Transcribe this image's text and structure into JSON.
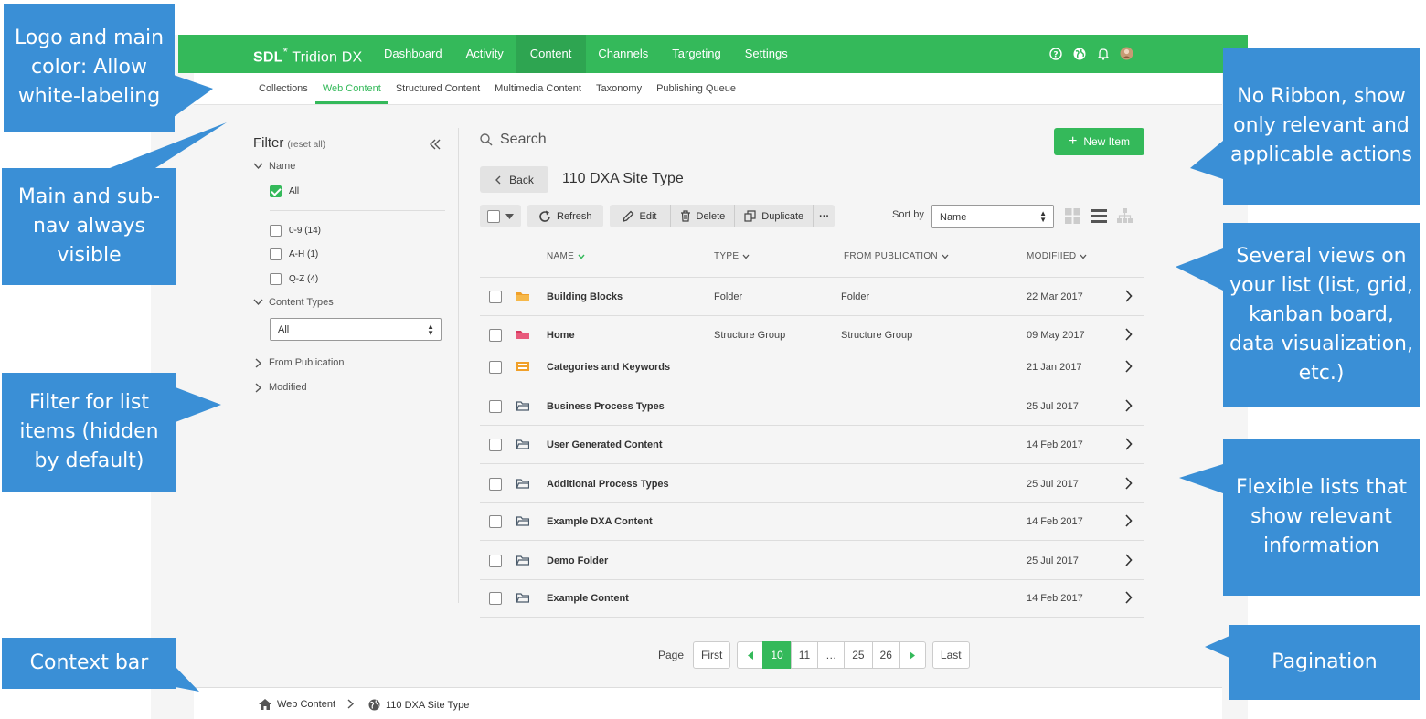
{
  "brand": {
    "logo_bold": "SDL",
    "logo_star": "*",
    "logo_rest": " Tridion DX",
    "color": "#34b95a"
  },
  "nav": {
    "items": [
      "Dashboard",
      "Activity",
      "Content",
      "Channels",
      "Targeting",
      "Settings"
    ],
    "active": "Content"
  },
  "top_icons": [
    "help-icon",
    "globe-icon",
    "bell-icon",
    "avatar"
  ],
  "subnav": {
    "items": [
      "Collections",
      "Web Content",
      "Structured Content",
      "Multimedia Content",
      "Taxonomy",
      "Publishing Queue"
    ],
    "active": "Web Content"
  },
  "filter": {
    "title": "Filter",
    "reset": "(reset all)",
    "name_section": "Name",
    "all_option": "All",
    "options": [
      "0-9 (14)",
      "A-H (1)",
      "Q-Z (4)"
    ],
    "content_types_section": "Content Types",
    "content_types_value": "All",
    "from_publication_section": "From Publication",
    "modified_section": "Modified"
  },
  "search": {
    "placeholder": "Search"
  },
  "new_item": "New Item",
  "back": "Back",
  "page_title": "110 DXA Site Type",
  "toolbar": {
    "refresh": "Refresh",
    "edit": "Edit",
    "delete": "Delete",
    "duplicate": "Duplicate",
    "more": "···"
  },
  "sort": {
    "label": "Sort by",
    "value": "Name"
  },
  "table": {
    "headers": {
      "name": "NAME",
      "type": "TYPE",
      "pub": "FROM PUBLICATION",
      "mod": "MODIFIIED"
    },
    "rows": [
      {
        "name": "Building Blocks",
        "type": "Folder",
        "pub": "Folder",
        "mod": "22 Mar 2017",
        "icon": "folder-orange"
      },
      {
        "name": "Home",
        "type": "Structure Group",
        "pub": "Structure Group",
        "mod": "09 May 2017",
        "icon": "folder-pink"
      },
      {
        "name": "Categories and Keywords",
        "type": "",
        "pub": "",
        "mod": "21 Jan 2017",
        "icon": "category-orange"
      },
      {
        "name": "Business Process Types",
        "type": "",
        "pub": "",
        "mod": "25 Jul 2017",
        "icon": "folder-gray"
      },
      {
        "name": "User Generated Content",
        "type": "",
        "pub": "",
        "mod": "14 Feb 2017",
        "icon": "folder-gray"
      },
      {
        "name": "Additional Process Types",
        "type": "",
        "pub": "",
        "mod": "25 Jul 2017",
        "icon": "folder-gray"
      },
      {
        "name": "Example DXA Content",
        "type": "",
        "pub": "",
        "mod": "14 Feb 2017",
        "icon": "folder-gray"
      },
      {
        "name": "Demo Folder",
        "type": "",
        "pub": "",
        "mod": "25 Jul 2017",
        "icon": "folder-gray"
      },
      {
        "name": "Example  Content",
        "type": "",
        "pub": "",
        "mod": "14 Feb 2017",
        "icon": "folder-gray"
      }
    ]
  },
  "pagination": {
    "label": "Page",
    "first": "First",
    "pages": [
      "10",
      "11",
      "…",
      "25",
      "26"
    ],
    "active": "10",
    "last": "Last"
  },
  "context": {
    "home": "Web Content",
    "current": "110 DXA Site Type"
  },
  "callouts": {
    "logo": "Logo and main color: Allow white-labeling",
    "nav": "Main and sub-nav always visible",
    "filter": "Filter for list items (hidden by default)",
    "context": "Context bar",
    "ribbon": "No Ribbon, show only relevant and applicable actions",
    "views": "Several views on your list (list, grid, kanban board, data visualization, etc.)",
    "lists": "Flexible lists that show relevant information",
    "pagination": "Pagination"
  },
  "callout_color": "#3a8fd6"
}
